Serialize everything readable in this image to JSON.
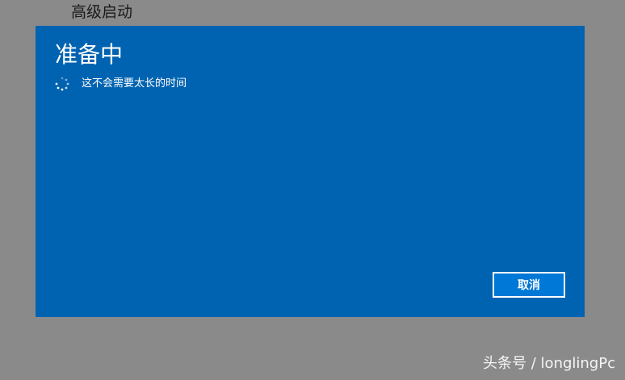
{
  "window": {
    "title": "高级启动"
  },
  "dialog": {
    "heading": "准备中",
    "progress_text": "这不会需要太长的时间",
    "cancel_label": "取消",
    "background_color": "#0063b1",
    "button_color": "#0078d7",
    "spinner_icon": "loading-spinner-icon"
  },
  "watermark": {
    "text": "头条号 / longlingPc"
  }
}
